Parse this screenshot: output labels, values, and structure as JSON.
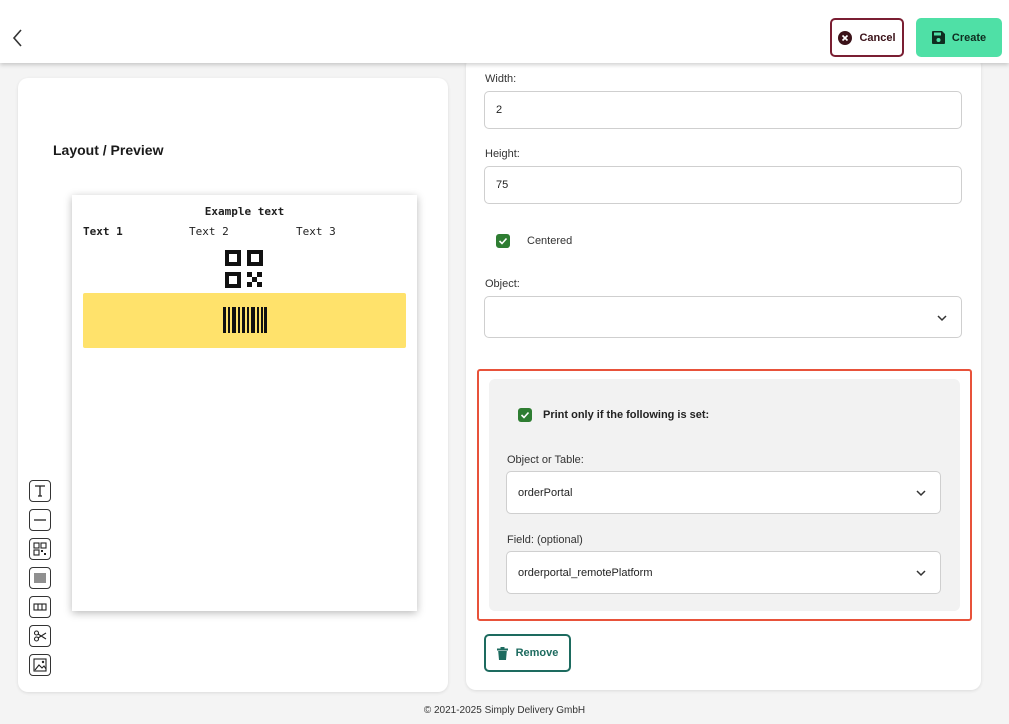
{
  "header": {
    "cancel_label": "Cancel",
    "create_label": "Create",
    "icons": {
      "back": "chevron-left-icon",
      "cancel": "x-circle-icon",
      "create": "floppy-disk-icon"
    },
    "colors": {
      "cancel_border": "#7a1e32",
      "create_bg": "#4fe0a6"
    }
  },
  "preview": {
    "title": "Layout / Preview",
    "example_title": "Example text",
    "texts": [
      "Text 1",
      "Text 2",
      "Text 3"
    ],
    "barcode_band_color": "#ffe26b",
    "tools": [
      "text-tool-icon",
      "line-tool-icon",
      "qr-tool-icon",
      "barcode-tool-icon",
      "table-tool-icon",
      "cut-tool-icon",
      "image-tool-icon"
    ]
  },
  "form": {
    "width_label": "Width:",
    "width_value": "2",
    "height_label": "Height:",
    "height_value": "75",
    "centered_label": "Centered",
    "centered_checked": true,
    "object_label": "Object:",
    "object_value": "",
    "condition": {
      "enabled_label": "Print only if the following is set:",
      "enabled_checked": true,
      "object_table_label": "Object or Table:",
      "object_table_value": "orderPortal",
      "field_label": "Field: (optional)",
      "field_value": "orderportal_remotePlatform",
      "highlight_color": "#e8523a"
    },
    "remove_label": "Remove"
  },
  "footer": {
    "text": "© 2021-2025 Simply Delivery GmbH"
  }
}
